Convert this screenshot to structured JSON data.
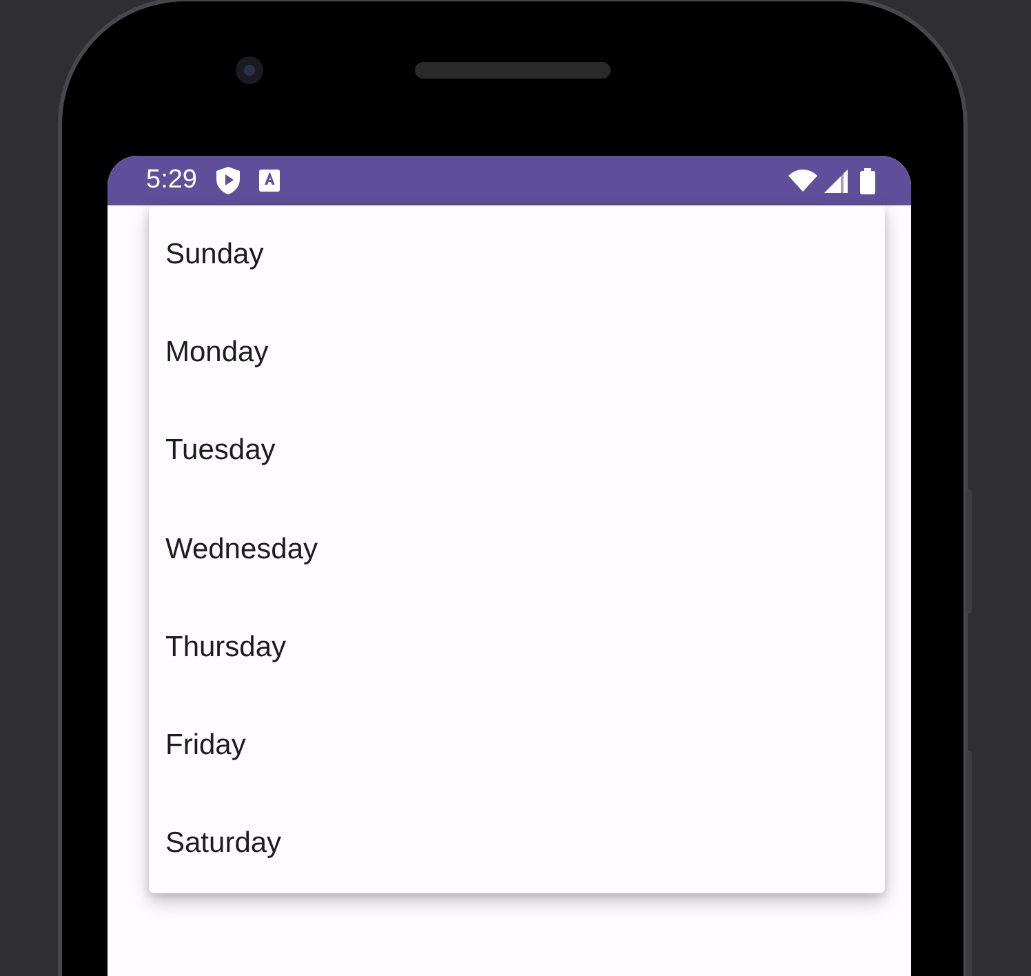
{
  "status_bar": {
    "time": "5:29"
  },
  "menu": {
    "items": [
      {
        "label": "Sunday"
      },
      {
        "label": "Monday"
      },
      {
        "label": "Tuesday"
      },
      {
        "label": "Wednesday"
      },
      {
        "label": "Thursday"
      },
      {
        "label": "Friday"
      },
      {
        "label": "Saturday"
      }
    ]
  }
}
